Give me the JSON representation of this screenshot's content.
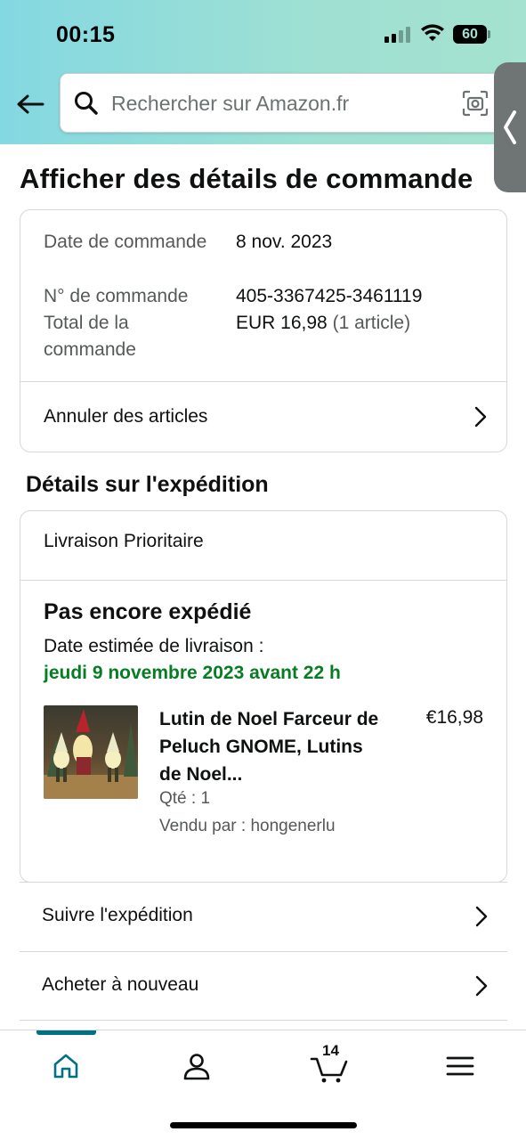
{
  "status_bar": {
    "time": "00:15",
    "battery": "60"
  },
  "header": {
    "search_placeholder": "Rechercher sur Amazon.fr"
  },
  "page_title": "Afficher des détails de commande",
  "order_summary": {
    "date_label": "Date de commande",
    "date_value": "8 nov. 2023",
    "number_label": "N° de commande",
    "number_value": "405-3367425-3461119",
    "total_label": "Total de la commande",
    "total_value": "EUR 16,98",
    "total_items": "(1 article)",
    "cancel_label": "Annuler des articles"
  },
  "shipping": {
    "section_title": "Détails sur l'expédition",
    "method": "Livraison Prioritaire",
    "status": "Pas encore expédié",
    "eta_label": "Date estimée de livraison :",
    "eta_date": "jeudi 9 novembre 2023 avant 22 h",
    "item": {
      "title": "Lutin de Noel Farceur de Peluch GNOME, Lutins de Noel...",
      "price": "€16,98",
      "qty": "Qté : 1",
      "seller": "Vendu par : hongenerlu"
    }
  },
  "actions": {
    "track": "Suivre l'expédition",
    "buy_again": "Acheter à nouveau"
  },
  "bottom_nav": {
    "cart_count": "14",
    "active": "home"
  },
  "colors": {
    "accent": "#007185",
    "eta_green": "#067d22",
    "header_gradient": "#84d8e2"
  },
  "icons": [
    "back-arrow-icon",
    "search-icon",
    "camera-icon",
    "chevron-left-icon",
    "chevron-right-icon",
    "home-icon",
    "account-icon",
    "cart-icon",
    "menu-icon"
  ]
}
